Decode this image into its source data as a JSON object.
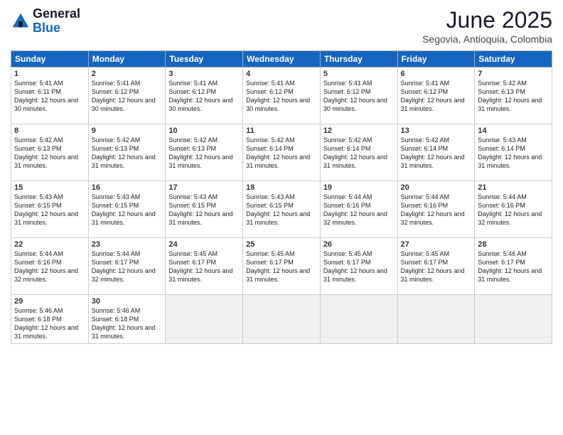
{
  "logo": {
    "general": "General",
    "blue": "Blue"
  },
  "title": "June 2025",
  "subtitle": "Segovia, Antioquia, Colombia",
  "header_days": [
    "Sunday",
    "Monday",
    "Tuesday",
    "Wednesday",
    "Thursday",
    "Friday",
    "Saturday"
  ],
  "weeks": [
    [
      {
        "day": 1,
        "sunrise": "5:41 AM",
        "sunset": "6:11 PM",
        "daylight": "12 hours and 30 minutes."
      },
      {
        "day": 2,
        "sunrise": "5:41 AM",
        "sunset": "6:12 PM",
        "daylight": "12 hours and 30 minutes."
      },
      {
        "day": 3,
        "sunrise": "5:41 AM",
        "sunset": "6:12 PM",
        "daylight": "12 hours and 30 minutes."
      },
      {
        "day": 4,
        "sunrise": "5:41 AM",
        "sunset": "6:12 PM",
        "daylight": "12 hours and 30 minutes."
      },
      {
        "day": 5,
        "sunrise": "5:41 AM",
        "sunset": "6:12 PM",
        "daylight": "12 hours and 30 minutes."
      },
      {
        "day": 6,
        "sunrise": "5:41 AM",
        "sunset": "6:12 PM",
        "daylight": "12 hours and 31 minutes."
      },
      {
        "day": 7,
        "sunrise": "5:42 AM",
        "sunset": "6:13 PM",
        "daylight": "12 hours and 31 minutes."
      }
    ],
    [
      {
        "day": 8,
        "sunrise": "5:42 AM",
        "sunset": "6:13 PM",
        "daylight": "12 hours and 31 minutes."
      },
      {
        "day": 9,
        "sunrise": "5:42 AM",
        "sunset": "6:13 PM",
        "daylight": "12 hours and 31 minutes."
      },
      {
        "day": 10,
        "sunrise": "5:42 AM",
        "sunset": "6:13 PM",
        "daylight": "12 hours and 31 minutes."
      },
      {
        "day": 11,
        "sunrise": "5:42 AM",
        "sunset": "6:14 PM",
        "daylight": "12 hours and 31 minutes."
      },
      {
        "day": 12,
        "sunrise": "5:42 AM",
        "sunset": "6:14 PM",
        "daylight": "12 hours and 31 minutes."
      },
      {
        "day": 13,
        "sunrise": "5:42 AM",
        "sunset": "6:14 PM",
        "daylight": "12 hours and 31 minutes."
      },
      {
        "day": 14,
        "sunrise": "5:43 AM",
        "sunset": "6:14 PM",
        "daylight": "12 hours and 31 minutes."
      }
    ],
    [
      {
        "day": 15,
        "sunrise": "5:43 AM",
        "sunset": "6:15 PM",
        "daylight": "12 hours and 31 minutes."
      },
      {
        "day": 16,
        "sunrise": "5:43 AM",
        "sunset": "6:15 PM",
        "daylight": "12 hours and 31 minutes."
      },
      {
        "day": 17,
        "sunrise": "5:43 AM",
        "sunset": "6:15 PM",
        "daylight": "12 hours and 31 minutes."
      },
      {
        "day": 18,
        "sunrise": "5:43 AM",
        "sunset": "6:15 PM",
        "daylight": "12 hours and 31 minutes."
      },
      {
        "day": 19,
        "sunrise": "5:44 AM",
        "sunset": "6:16 PM",
        "daylight": "12 hours and 32 minutes."
      },
      {
        "day": 20,
        "sunrise": "5:44 AM",
        "sunset": "6:16 PM",
        "daylight": "12 hours and 32 minutes."
      },
      {
        "day": 21,
        "sunrise": "5:44 AM",
        "sunset": "6:16 PM",
        "daylight": "12 hours and 32 minutes."
      }
    ],
    [
      {
        "day": 22,
        "sunrise": "5:44 AM",
        "sunset": "6:16 PM",
        "daylight": "12 hours and 32 minutes."
      },
      {
        "day": 23,
        "sunrise": "5:44 AM",
        "sunset": "6:17 PM",
        "daylight": "12 hours and 32 minutes."
      },
      {
        "day": 24,
        "sunrise": "5:45 AM",
        "sunset": "6:17 PM",
        "daylight": "12 hours and 31 minutes."
      },
      {
        "day": 25,
        "sunrise": "5:45 AM",
        "sunset": "6:17 PM",
        "daylight": "12 hours and 31 minutes."
      },
      {
        "day": 26,
        "sunrise": "5:45 AM",
        "sunset": "6:17 PM",
        "daylight": "12 hours and 31 minutes."
      },
      {
        "day": 27,
        "sunrise": "5:45 AM",
        "sunset": "6:17 PM",
        "daylight": "12 hours and 31 minutes."
      },
      {
        "day": 28,
        "sunrise": "5:46 AM",
        "sunset": "6:17 PM",
        "daylight": "12 hours and 31 minutes."
      }
    ],
    [
      {
        "day": 29,
        "sunrise": "5:46 AM",
        "sunset": "6:18 PM",
        "daylight": "12 hours and 31 minutes."
      },
      {
        "day": 30,
        "sunrise": "5:46 AM",
        "sunset": "6:18 PM",
        "daylight": "12 hours and 31 minutes."
      },
      null,
      null,
      null,
      null,
      null
    ]
  ]
}
